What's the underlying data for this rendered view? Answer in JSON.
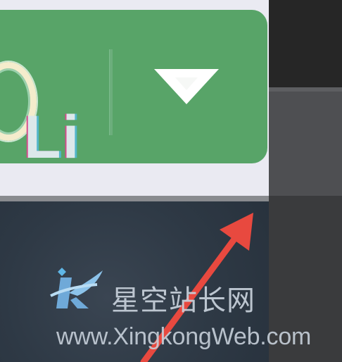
{
  "toolbar": {
    "dropdown_icon": "triangle-down-icon",
    "button_color": "#58a468"
  },
  "column_header": {
    "label": "Li"
  },
  "annotation": {
    "arrow_color": "#e8493f"
  },
  "watermark": {
    "logo_icon": "xingkong-logo-icon",
    "cn_text": "星空站长网",
    "url_text": "www.XingkongWeb.com"
  }
}
